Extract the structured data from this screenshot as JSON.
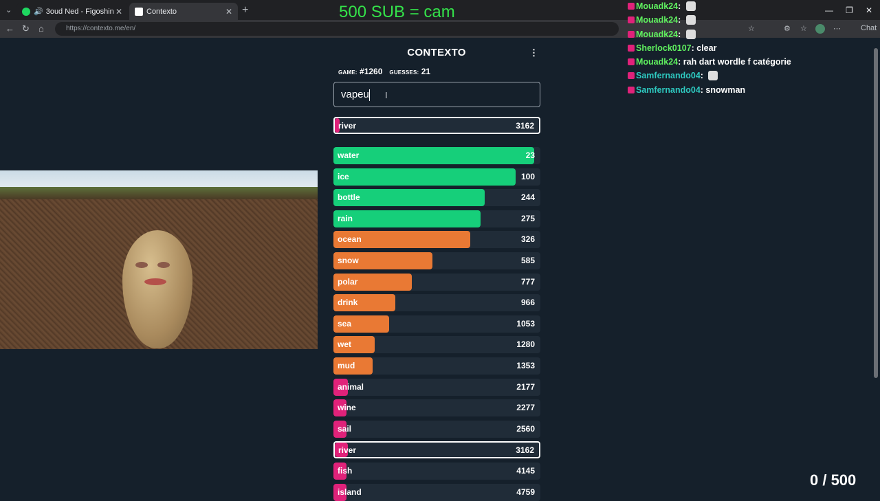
{
  "browser": {
    "tabs": [
      {
        "label": "3oud Ned - Figoshin"
      },
      {
        "label": "Contexto"
      }
    ],
    "url": "https://contexto.me/en/",
    "chat_label": "Chat"
  },
  "game": {
    "logo": "CONTEXTO",
    "game_label": "GAME:",
    "game_number": "#1260",
    "guesses_label": "GUESSES:",
    "guesses_count": "21",
    "input_value": "vapeu",
    "last_guess": {
      "word": "river",
      "rank": "3162",
      "color": "#e0227a",
      "fill": 0.01
    },
    "guesses": [
      {
        "word": "water",
        "rank": "23",
        "color": "#16cf7a",
        "fill": 0.97
      },
      {
        "word": "ice",
        "rank": "100",
        "color": "#16cf7a",
        "fill": 0.88
      },
      {
        "word": "bottle",
        "rank": "244",
        "color": "#16cf7a",
        "fill": 0.73
      },
      {
        "word": "rain",
        "rank": "275",
        "color": "#16cf7a",
        "fill": 0.71
      },
      {
        "word": "ocean",
        "rank": "326",
        "color": "#e97934",
        "fill": 0.66
      },
      {
        "word": "snow",
        "rank": "585",
        "color": "#e97934",
        "fill": 0.48
      },
      {
        "word": "polar",
        "rank": "777",
        "color": "#e97934",
        "fill": 0.38
      },
      {
        "word": "drink",
        "rank": "966",
        "color": "#e97934",
        "fill": 0.3
      },
      {
        "word": "sea",
        "rank": "1053",
        "color": "#e97934",
        "fill": 0.27
      },
      {
        "word": "wet",
        "rank": "1280",
        "color": "#e97934",
        "fill": 0.2
      },
      {
        "word": "mud",
        "rank": "1353",
        "color": "#e97934",
        "fill": 0.19
      },
      {
        "word": "animal",
        "rank": "2177",
        "color": "#e0227a",
        "fill": 0.07
      },
      {
        "word": "wine",
        "rank": "2277",
        "color": "#e0227a",
        "fill": 0.02
      },
      {
        "word": "sail",
        "rank": "2560",
        "color": "#e0227a",
        "fill": 0.02
      },
      {
        "word": "river",
        "rank": "3162",
        "color": "#e0227a",
        "fill": 0.01,
        "highlighted": true
      },
      {
        "word": "fish",
        "rank": "4145",
        "color": "#e0227a",
        "fill": 0.01
      },
      {
        "word": "island",
        "rank": "4759",
        "color": "#e0227a",
        "fill": 0.01
      }
    ]
  },
  "stream": {
    "goal_text": "500 SUB = cam",
    "chat": [
      {
        "user": "Mouadk24",
        "message": "",
        "emote": true,
        "badge": "#e0227a"
      },
      {
        "user": "Mouadk24",
        "message": "",
        "emote": true,
        "badge": "#e0227a"
      },
      {
        "user": "Mouadk24",
        "message": "",
        "emote": true,
        "badge": "#e0227a"
      },
      {
        "user": "Sherlock0107",
        "message": "clear",
        "emote": false,
        "badge": "#e0227a"
      },
      {
        "user": "Mouadk24",
        "message": "rah dart wordle f catégorie",
        "emote": false,
        "badge": "#e0227a"
      },
      {
        "user": "Samfernando04",
        "message": "",
        "emote": true,
        "badge": "#e0227a",
        "teal": true
      },
      {
        "user": "Samfernando04",
        "message": "snowman",
        "emote": false,
        "badge": "#e0227a",
        "teal": true
      }
    ],
    "counter": "0 / 500"
  }
}
